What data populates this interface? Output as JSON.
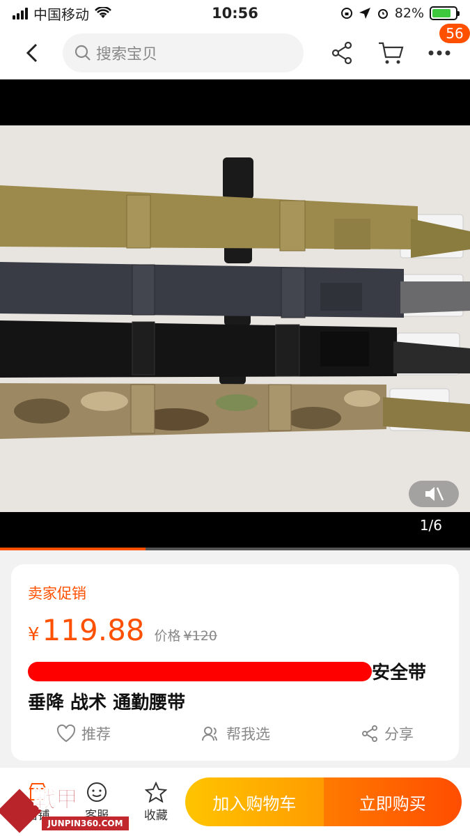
{
  "status": {
    "carrier": "中国移动",
    "time": "10:56",
    "battery": "82%",
    "battery_level": 0.82
  },
  "header": {
    "search_placeholder": "搜索宝贝",
    "badge_count": "56"
  },
  "media": {
    "counter": "1/6",
    "progress": 0.31
  },
  "product": {
    "promo_label": "卖家促销",
    "currency": "¥",
    "price": "119.88",
    "orig_label": "价格",
    "orig_price": "¥120",
    "title_line1_suffix": "安全带",
    "title_line2": "垂降 战术 通勤腰带",
    "actions": {
      "recommend": "推荐",
      "help_choose": "帮我选",
      "share": "分享"
    }
  },
  "bottom": {
    "shop": "店铺",
    "service": "客服",
    "favorite": "收藏",
    "add_cart": "加入购物车",
    "buy_now": "立即购买"
  },
  "watermark": {
    "brand": "戦甲",
    "site": "JUNPIN360.COM"
  },
  "colors": {
    "accent": "#ff5000",
    "cart_button": "#ffb300",
    "buy_button": "#ff5a00"
  }
}
